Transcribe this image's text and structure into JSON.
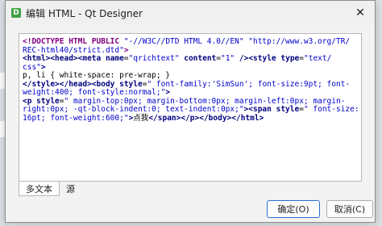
{
  "window": {
    "title": "编辑 HTML - Qt Designer",
    "app_icon_letter": "D",
    "close_symbol": "✕"
  },
  "editor": {
    "lines": [
      [
        {
          "t": "<!DOCTYPE HTML PUBLIC ",
          "c": "tag"
        },
        {
          "t": "\"-//W3C//DTD HTML 4.0//EN\" \"http://www.w3.org/TR/",
          "c": "val"
        }
      ],
      [
        {
          "t": "REC-html40/strict.dtd\"",
          "c": "val"
        },
        {
          "t": ">",
          "c": "tag"
        }
      ],
      [
        {
          "t": "<html><head><meta ",
          "c": "tagbold"
        },
        {
          "t": "name",
          "c": "attrb"
        },
        {
          "t": "=",
          "c": "plain"
        },
        {
          "t": "\"qrichtext\"",
          "c": "val"
        },
        {
          "t": " content",
          "c": "attrb"
        },
        {
          "t": "=",
          "c": "plain"
        },
        {
          "t": "\"1\"",
          "c": "val"
        },
        {
          "t": " /><style ",
          "c": "tagbold"
        },
        {
          "t": "type",
          "c": "attrb"
        },
        {
          "t": "=",
          "c": "plain"
        },
        {
          "t": "\"text/",
          "c": "val"
        }
      ],
      [
        {
          "t": "css\"",
          "c": "val"
        },
        {
          "t": ">",
          "c": "tagbold"
        }
      ],
      [
        {
          "t": "p, li { white-space: pre-wrap; }",
          "c": "plain"
        }
      ],
      [
        {
          "t": "</style></head><body ",
          "c": "tagbold"
        },
        {
          "t": "style",
          "c": "attrb"
        },
        {
          "t": "=",
          "c": "plain"
        },
        {
          "t": "\" font-family:'SimSun'; font-size:9pt; font-",
          "c": "val"
        }
      ],
      [
        {
          "t": "weight:400; font-style:normal;\"",
          "c": "val"
        },
        {
          "t": ">",
          "c": "tagbold"
        }
      ],
      [
        {
          "t": "<p ",
          "c": "tagbold"
        },
        {
          "t": "style",
          "c": "attrb"
        },
        {
          "t": "=",
          "c": "plain"
        },
        {
          "t": "\" margin-top:0px; margin-bottom:0px; margin-left:0px; margin-",
          "c": "val"
        }
      ],
      [
        {
          "t": "right:0px; -qt-block-indent:0; text-indent:0px;\"",
          "c": "val"
        },
        {
          "t": "><span ",
          "c": "tagbold"
        },
        {
          "t": "style",
          "c": "attrb"
        },
        {
          "t": "=",
          "c": "plain"
        },
        {
          "t": "\" font-size:",
          "c": "val"
        }
      ],
      [
        {
          "t": "16pt; font-weight:600;\"",
          "c": "val"
        },
        {
          "t": ">",
          "c": "tagbold"
        },
        {
          "t": "点我",
          "c": "plain"
        },
        {
          "t": "</span></p></body></html>",
          "c": "tagbold"
        }
      ]
    ]
  },
  "tabs": {
    "rich_text": "多文本",
    "source": "源"
  },
  "buttons": {
    "ok": "确定(O)",
    "cancel": "取消(C)"
  }
}
